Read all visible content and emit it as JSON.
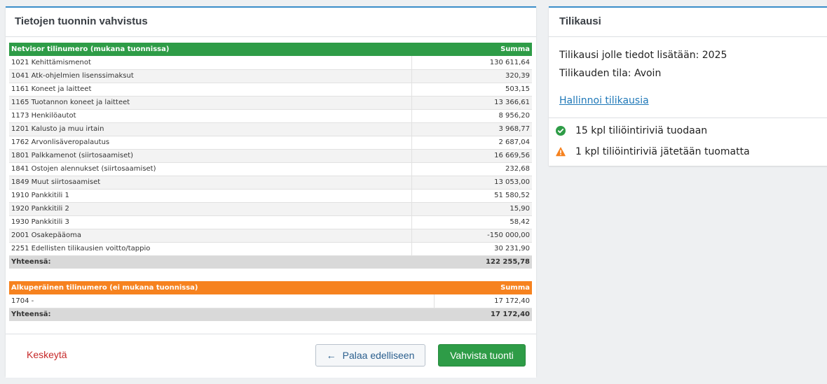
{
  "left_panel": {
    "title": "Tietojen tuonnin vahvistus",
    "included_table": {
      "header_account": "Netvisor tilinumero (mukana tuonnissa)",
      "header_sum": "Summa",
      "rows": [
        {
          "account": "1021 Kehittämismenot",
          "sum": "130 611,64"
        },
        {
          "account": "1041 Atk-ohjelmien lisenssimaksut",
          "sum": "320,39"
        },
        {
          "account": "1161 Koneet ja laitteet",
          "sum": "503,15"
        },
        {
          "account": "1165 Tuotannon koneet ja laitteet",
          "sum": "13 366,61"
        },
        {
          "account": "1173 Henkilöautot",
          "sum": "8 956,20"
        },
        {
          "account": "1201 Kalusto ja muu irtain",
          "sum": "3 968,77"
        },
        {
          "account": "1762 Arvonlisäveropalautus",
          "sum": "2 687,04"
        },
        {
          "account": "1801 Palkkamenot (siirtosaamiset)",
          "sum": "16 669,56"
        },
        {
          "account": "1841 Ostojen alennukset (siirtosaamiset)",
          "sum": "232,68"
        },
        {
          "account": "1849 Muut siirtosaamiset",
          "sum": "13 053,00"
        },
        {
          "account": "1910 Pankkitili 1",
          "sum": "51 580,52"
        },
        {
          "account": "1920 Pankkitili 2",
          "sum": "15,90"
        },
        {
          "account": "1930 Pankkitili 3",
          "sum": "58,42"
        },
        {
          "account": "2001 Osakepääoma",
          "sum": "-150 000,00"
        },
        {
          "account": "2251 Edellisten tilikausien voitto/tappio",
          "sum": "30 231,90"
        }
      ],
      "total_label": "Yhteensä:",
      "total_value": "122 255,78"
    },
    "excluded_table": {
      "header_account": "Alkuperäinen tilinumero (ei mukana tuonnissa)",
      "header_sum": "Summa",
      "rows": [
        {
          "account": "1704 -",
          "sum": "17 172,40"
        }
      ],
      "total_label": "Yhteensä:",
      "total_value": "17 172,40"
    },
    "footer": {
      "cancel_label": "Keskeytä",
      "back_label": "Palaa edelliseen",
      "confirm_label": "Vahvista tuonti"
    }
  },
  "right_panel": {
    "title": "Tilikausi",
    "year_line": "Tilikausi jolle tiedot lisätään: 2025",
    "state_line": "Tilikauden tila: Avoin",
    "manage_link": "Hallinnoi tilikausia",
    "status_ok": "15 kpl tiliöintiriviä tuodaan",
    "status_warn": "1 kpl tiliöintiriviä jätetään tuomatta"
  },
  "colors": {
    "accent_green": "#2e9c47",
    "accent_orange": "#f6821f",
    "link_blue": "#1f78b8",
    "cancel_red": "#c62828"
  },
  "icons": {
    "status_ok": "check-circle-icon",
    "status_warn": "warning-triangle-icon",
    "back": "arrow-left-icon"
  }
}
